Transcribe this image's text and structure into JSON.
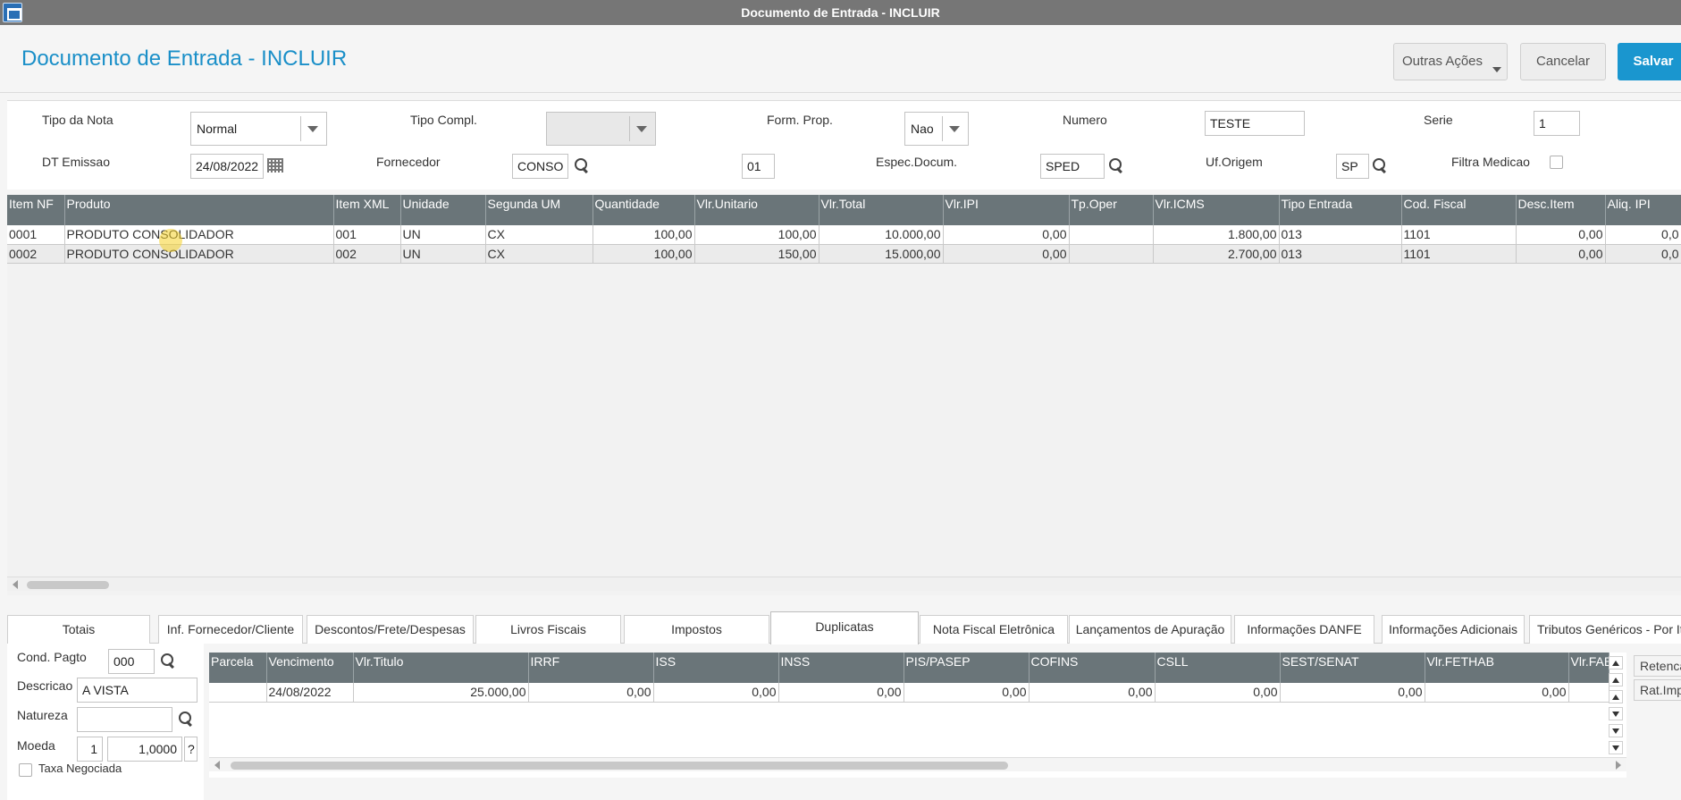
{
  "window": {
    "title": "Documento de Entrada - INCLUIR"
  },
  "header": {
    "title": "Documento de Entrada - INCLUIR",
    "buttons": {
      "outras": "Outras Ações",
      "cancelar": "Cancelar",
      "salvar": "Salvar"
    }
  },
  "form": {
    "tipo_nota": {
      "label": "Tipo da Nota",
      "value": "Normal"
    },
    "tipo_compl": {
      "label": "Tipo Compl.",
      "value": ""
    },
    "form_prop": {
      "label": "Form. Prop.",
      "value": "Nao"
    },
    "numero": {
      "label": "Numero",
      "value": "TESTE"
    },
    "serie": {
      "label": "Serie",
      "value": "1"
    },
    "dt_emissao": {
      "label": "DT Emissao",
      "value": "24/08/2022"
    },
    "fornecedor": {
      "label": "Fornecedor",
      "value": "CONSO",
      "loja": "01"
    },
    "espec_docum": {
      "label": "Espec.Docum.",
      "value": "SPED"
    },
    "uf_origem": {
      "label": "Uf.Origem",
      "value": "SP"
    },
    "filtra_medicao": {
      "label": "Filtra Medicao",
      "checked": false
    }
  },
  "items_grid": {
    "columns": [
      "Item NF",
      "Produto",
      "Item XML",
      "Unidade",
      "Segunda UM",
      "Quantidade",
      "Vlr.Unitario",
      "Vlr.Total",
      "Vlr.IPI",
      "Tp.Oper",
      "Vlr.ICMS",
      "Tipo Entrada",
      "Cod. Fiscal",
      "Desc.Item",
      "Aliq. IPI"
    ],
    "rows": [
      [
        "0001",
        "PRODUTO CONSOLIDADOR",
        "001",
        "UN",
        "CX",
        "100,00",
        "100,00",
        "10.000,00",
        "0,00",
        "",
        "1.800,00",
        "013",
        "1101",
        "0,00",
        "0,0"
      ],
      [
        "0002",
        "PRODUTO CONSOLIDADOR",
        "002",
        "UN",
        "CX",
        "100,00",
        "150,00",
        "15.000,00",
        "0,00",
        "",
        "2.700,00",
        "013",
        "1101",
        "0,00",
        "0,0"
      ]
    ]
  },
  "tabs": [
    "Totais",
    "Inf. Fornecedor/Cliente",
    "Descontos/Frete/Despesas",
    "Livros Fiscais",
    "Impostos",
    "Duplicatas",
    "Nota Fiscal Eletrônica",
    "Lançamentos de Apuração",
    "Informações DANFE",
    "Informações Adicionais",
    "Tributos Genéricos - Por It"
  ],
  "active_tab": "Duplicatas",
  "duplicatas": {
    "cond_pagto": {
      "label": "Cond. Pagto",
      "value": "000"
    },
    "descricao": {
      "label": "Descricao",
      "value": "A VISTA"
    },
    "natureza": {
      "label": "Natureza",
      "value": ""
    },
    "moeda": {
      "label": "Moeda",
      "value": "1",
      "taxa": "1,0000",
      "help": "?"
    },
    "taxa_negociada": {
      "label": "Taxa Negociada",
      "checked": false
    },
    "grid": {
      "columns": [
        "Parcela",
        "Vencimento",
        "Vlr.Titulo",
        "IRRF",
        "ISS",
        "INSS",
        "PIS/PASEP",
        "COFINS",
        "CSLL",
        "SEST/SENAT",
        "Vlr.FETHAB",
        "Vlr.FAB"
      ],
      "rows": [
        [
          "",
          "24/08/2022",
          "25.000,00",
          "0,00",
          "0,00",
          "0,00",
          "0,00",
          "0,00",
          "0,00",
          "0,00",
          "0,00",
          ""
        ]
      ]
    },
    "side_buttons": [
      "Retenca",
      "Rat.Imp"
    ]
  }
}
